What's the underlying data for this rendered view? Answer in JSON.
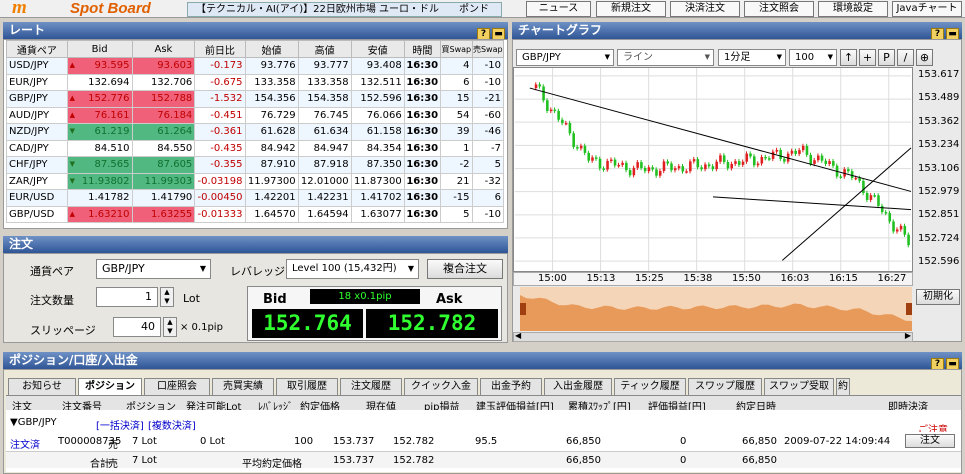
{
  "app": {
    "logo_mark": "m",
    "logo_text": "Spot Board"
  },
  "ticker": "【テクニカル・AI(アイ)】22日欧州市場 ユーロ・ドル　　ポンド",
  "top_buttons": [
    "ニュース",
    "新規注文",
    "決済注文",
    "注文照会",
    "環境設定",
    "Javaチャート"
  ],
  "rate": {
    "title": "レート",
    "headers": [
      "通貨ペア",
      "Bid",
      "Ask",
      "前日比",
      "始値",
      "高値",
      "安値",
      "時間",
      "買Swap",
      "売Swap"
    ],
    "rows": [
      {
        "pair": "USD/JPY",
        "bid": "93.595",
        "ask": "93.603",
        "chg": "-0.173",
        "open": "93.776",
        "high": "93.777",
        "low": "93.408",
        "time": "16:30",
        "bs": "4",
        "ss": "-10",
        "dir": "up"
      },
      {
        "pair": "EUR/JPY",
        "bid": "132.694",
        "ask": "132.706",
        "chg": "-0.675",
        "open": "133.358",
        "high": "133.358",
        "low": "132.511",
        "time": "16:30",
        "bs": "6",
        "ss": "-10",
        "dir": ""
      },
      {
        "pair": "GBP/JPY",
        "bid": "152.776",
        "ask": "152.788",
        "chg": "-1.532",
        "open": "154.356",
        "high": "154.358",
        "low": "152.596",
        "time": "16:30",
        "bs": "15",
        "ss": "-21",
        "dir": "up"
      },
      {
        "pair": "AUD/JPY",
        "bid": "76.161",
        "ask": "76.184",
        "chg": "-0.451",
        "open": "76.729",
        "high": "76.745",
        "low": "76.066",
        "time": "16:30",
        "bs": "54",
        "ss": "-60",
        "dir": "up"
      },
      {
        "pair": "NZD/JPY",
        "bid": "61.219",
        "ask": "61.264",
        "chg": "-0.361",
        "open": "61.628",
        "high": "61.634",
        "low": "61.158",
        "time": "16:30",
        "bs": "39",
        "ss": "-46",
        "dir": "dn"
      },
      {
        "pair": "CAD/JPY",
        "bid": "84.510",
        "ask": "84.550",
        "chg": "-0.435",
        "open": "84.942",
        "high": "84.947",
        "low": "84.354",
        "time": "16:30",
        "bs": "1",
        "ss": "-7",
        "dir": ""
      },
      {
        "pair": "CHF/JPY",
        "bid": "87.565",
        "ask": "87.605",
        "chg": "-0.355",
        "open": "87.910",
        "high": "87.918",
        "low": "87.350",
        "time": "16:30",
        "bs": "-2",
        "ss": "5",
        "dir": "dn"
      },
      {
        "pair": "ZAR/JPY",
        "bid": "11.93802",
        "ask": "11.99303",
        "chg": "-0.03198",
        "open": "11.97300",
        "high": "12.01000",
        "low": "11.87300",
        "time": "16:30",
        "bs": "21",
        "ss": "-32",
        "dir": "dn"
      },
      {
        "pair": "EUR/USD",
        "bid": "1.41782",
        "ask": "1.41790",
        "chg": "-0.00450",
        "open": "1.42201",
        "high": "1.42231",
        "low": "1.41702",
        "time": "16:30",
        "bs": "-15",
        "ss": "6",
        "dir": ""
      },
      {
        "pair": "GBP/USD",
        "bid": "1.63210",
        "ask": "1.63255",
        "chg": "-0.01333",
        "open": "1.64570",
        "high": "1.64594",
        "low": "1.63077",
        "time": "16:30",
        "bs": "5",
        "ss": "-10",
        "dir": "up"
      }
    ]
  },
  "order": {
    "title": "注文",
    "pair_label": "通貨ペア",
    "pair_value": "GBP/JPY",
    "leverage_label": "レバレッジ",
    "leverage_value": "Level 100 (15,432円)",
    "compound_button": "複合注文",
    "qty_label": "注文数量",
    "qty_value": "1",
    "qty_unit": "Lot",
    "slip_label": "スリッページ",
    "slip_value": "40",
    "slip_unit": "× 0.1pip",
    "bid_label": "Bid",
    "ask_label": "Ask",
    "spread": "18 x0.1pip",
    "bid_price": "152.764",
    "ask_price": "152.782"
  },
  "chart": {
    "title": "チャートグラフ",
    "pair": "GBP/JPY",
    "type": "ライン",
    "timeframe": "1分足",
    "count": "100",
    "tool_buttons": [
      "↑",
      "+",
      "P",
      "/",
      "⊕"
    ],
    "reset_button": "初期化",
    "x_labels": [
      "15:00",
      "15:13",
      "15:25",
      "15:38",
      "15:50",
      "16:03",
      "16:15",
      "16:27"
    ],
    "y_labels": [
      "153.617",
      "153.489",
      "153.362",
      "153.234",
      "153.106",
      "152.979",
      "152.851",
      "152.724",
      "152.596"
    ]
  },
  "chart_data": {
    "type": "line",
    "title": "",
    "xlabel": "",
    "ylabel": "",
    "x": [
      "15:00",
      "15:13",
      "15:25",
      "15:38",
      "15:50",
      "16:03",
      "16:15",
      "16:27"
    ],
    "ylim": [
      152.596,
      153.617
    ],
    "series": [
      {
        "values": [
          153.55,
          153.15,
          153.1,
          153.12,
          153.15,
          153.2,
          153.05,
          152.7
        ]
      }
    ]
  },
  "positions": {
    "title": "ポジション/口座/入出金",
    "tabs": [
      "お知らせ",
      "ポジション",
      "口座照会",
      "売買実績",
      "取引履歴",
      "注文履歴",
      "クイック入金",
      "出金予約",
      "入出金履歴",
      "ティック履歴",
      "スワップ履歴",
      "スワップ受取",
      "約"
    ],
    "headers": [
      "注文",
      "注文番号",
      "ポジション",
      "発注可能Lot",
      "ﾚﾊﾞﾚｯｼﾞ",
      "約定価格",
      "現在値",
      "pip損益",
      "建玉評価損益[円]",
      "累積ｽﾜｯﾌﾟ[円]",
      "評価損益[円]",
      "約定日時",
      "即時決済"
    ],
    "group_pair": "▼GBP/JPY",
    "group_link1": "[一括決済]",
    "group_link2": "[複数決済]",
    "caution": "ご注意",
    "row": {
      "status": "注文済",
      "number": "T000008735",
      "side": "売",
      "lots": "7 Lot",
      "avail": "0  Lot",
      "lev": "100",
      "price": "153.737",
      "current": "152.782",
      "pips": "95.5",
      "pl": "66,850",
      "swap": "0",
      "eval": "66,850",
      "date": "2009-07-22 14:09:44",
      "btn": "注文"
    },
    "total": {
      "label": "合計",
      "side": "売",
      "lots": "7 Lot",
      "avg_label": "平均約定価格",
      "price": "153.737",
      "current": "152.782",
      "pl": "66,850",
      "swap": "0",
      "eval": "66,850"
    }
  }
}
